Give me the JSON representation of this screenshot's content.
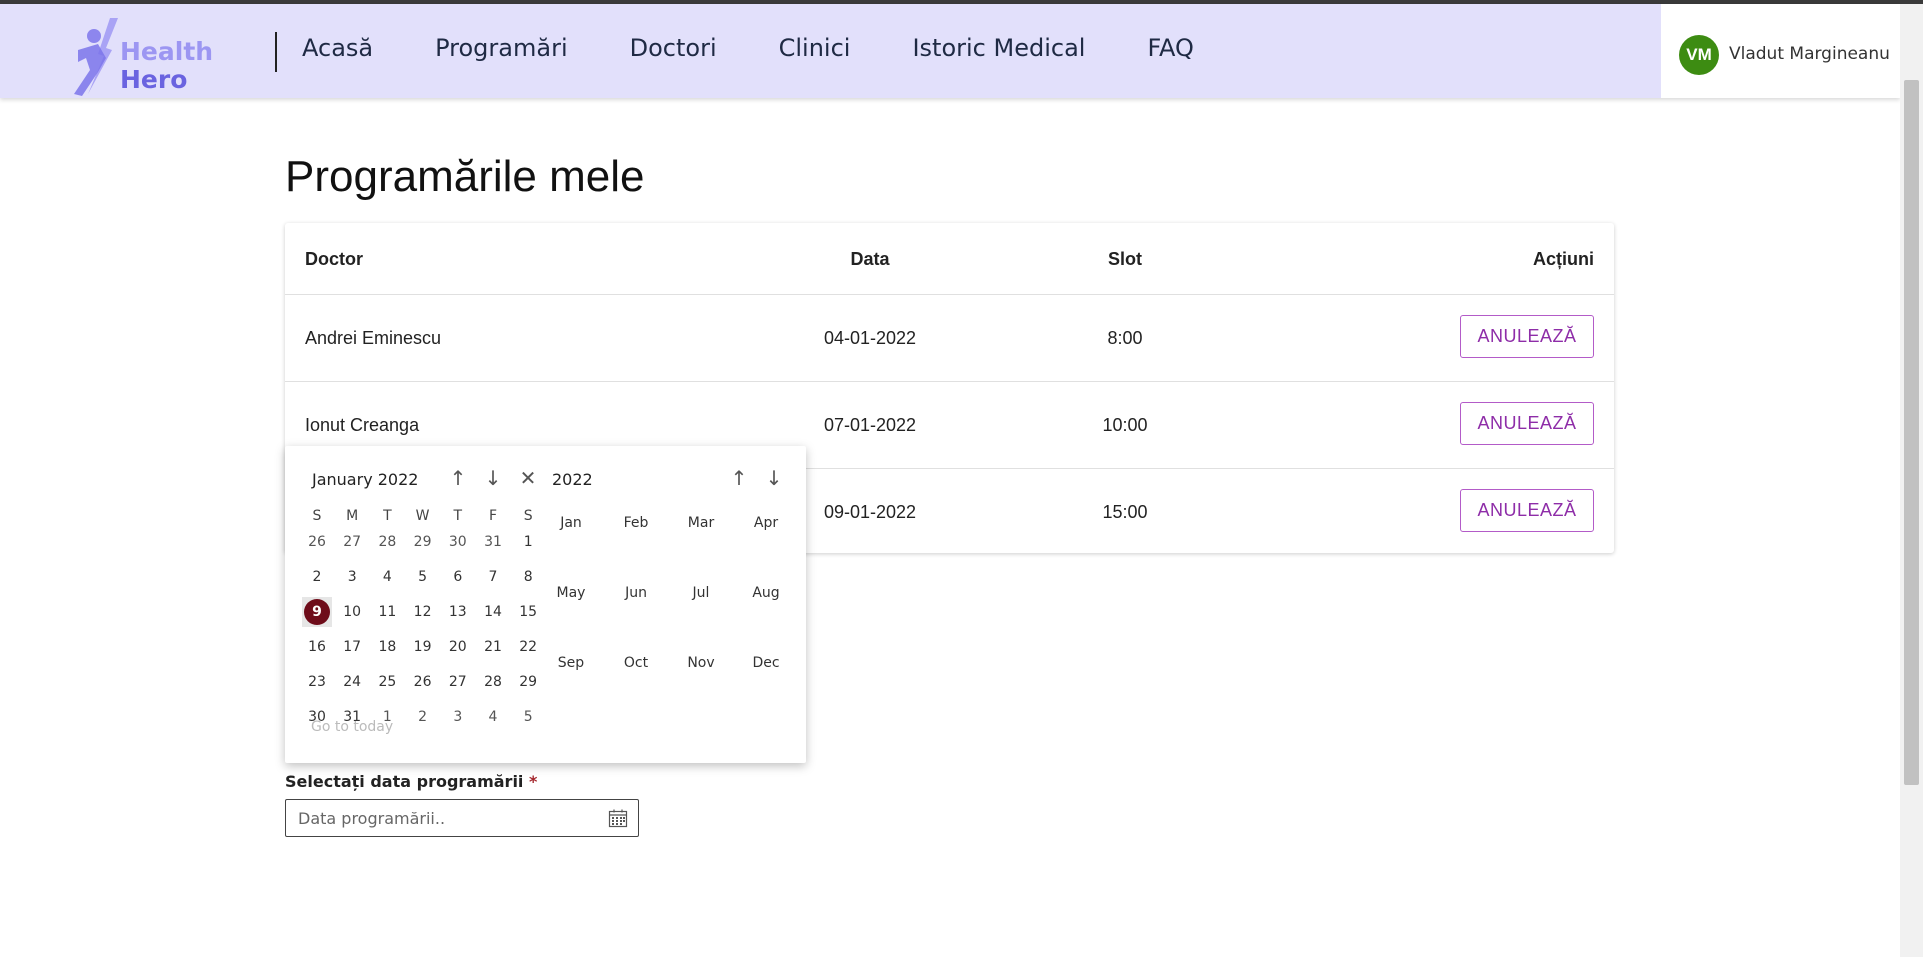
{
  "brand": {
    "line1": "Health",
    "line2": "Hero"
  },
  "nav": [
    "Acasă",
    "Programări",
    "Doctori",
    "Clinici",
    "Istoric Medical",
    "FAQ"
  ],
  "user": {
    "initials": "VM",
    "name": "Vladut Margineanu",
    "avatar_color": "#3d8c12"
  },
  "page_title": "Programările mele",
  "table": {
    "headers": {
      "doctor": "Doctor",
      "date": "Data",
      "slot": "Slot",
      "actions": "Acțiuni"
    },
    "rows": [
      {
        "doctor": "Andrei Eminescu",
        "date": "04-01-2022",
        "slot": "8:00",
        "action": "ANULEAZĂ"
      },
      {
        "doctor": "Ionut Creanga",
        "date": "07-01-2022",
        "slot": "10:00",
        "action": "ANULEAZĂ"
      },
      {
        "doctor": "",
        "date": "09-01-2022",
        "slot": "15:00",
        "action": "ANULEAZĂ"
      }
    ]
  },
  "datepicker": {
    "month_label": "January 2022",
    "year_label": "2022",
    "weekdays": [
      "S",
      "M",
      "T",
      "W",
      "T",
      "F",
      "S"
    ],
    "weeks": [
      [
        "26",
        "27",
        "28",
        "29",
        "30",
        "31",
        "1"
      ],
      [
        "2",
        "3",
        "4",
        "5",
        "6",
        "7",
        "8"
      ],
      [
        "9",
        "10",
        "11",
        "12",
        "13",
        "14",
        "15"
      ],
      [
        "16",
        "17",
        "18",
        "19",
        "20",
        "21",
        "22"
      ],
      [
        "23",
        "24",
        "25",
        "26",
        "27",
        "28",
        "29"
      ],
      [
        "30",
        "31",
        "1",
        "2",
        "3",
        "4",
        "5"
      ]
    ],
    "selected_day": "9",
    "goto_today": "Go to today",
    "months": [
      "Jan",
      "Feb",
      "Mar",
      "Apr",
      "May",
      "Jun",
      "Jul",
      "Aug",
      "Sep",
      "Oct",
      "Nov",
      "Dec"
    ],
    "accent": "#6e0c1a",
    "icons": {
      "prev": "arrow-up-icon",
      "next": "arrow-down-icon",
      "close": "close-icon"
    }
  },
  "form": {
    "label": "Selectați data programării",
    "required_mark": "*",
    "placeholder": "Data programării.."
  },
  "colors": {
    "header_bg": "#e2e0fb",
    "button_accent": "#8e2da8"
  }
}
